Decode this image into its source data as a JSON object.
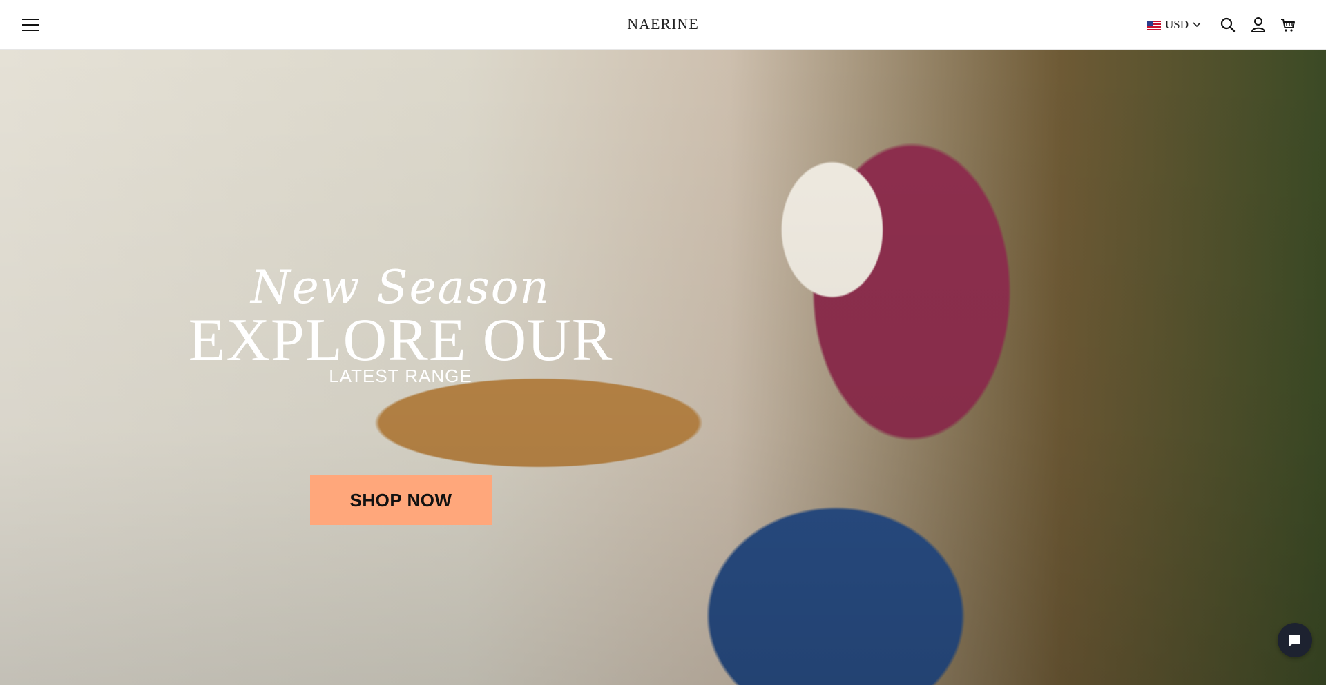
{
  "header": {
    "menu_icon": "hamburger-menu-icon",
    "logo": "NAERINE",
    "currency": {
      "flag": "us-flag-icon",
      "code": "USD",
      "caret": "chevron-down-icon"
    },
    "icons": [
      "search-icon",
      "account-icon",
      "cart-icon"
    ]
  },
  "hero": {
    "script_text": "New Season",
    "headline": "EXPLORE OUR",
    "subheadline": "LATEST RANGE",
    "cta_label": "SHOP NOW",
    "cta_color": "#ffa77b"
  },
  "chat": {
    "icon": "chat-bubble-icon"
  }
}
